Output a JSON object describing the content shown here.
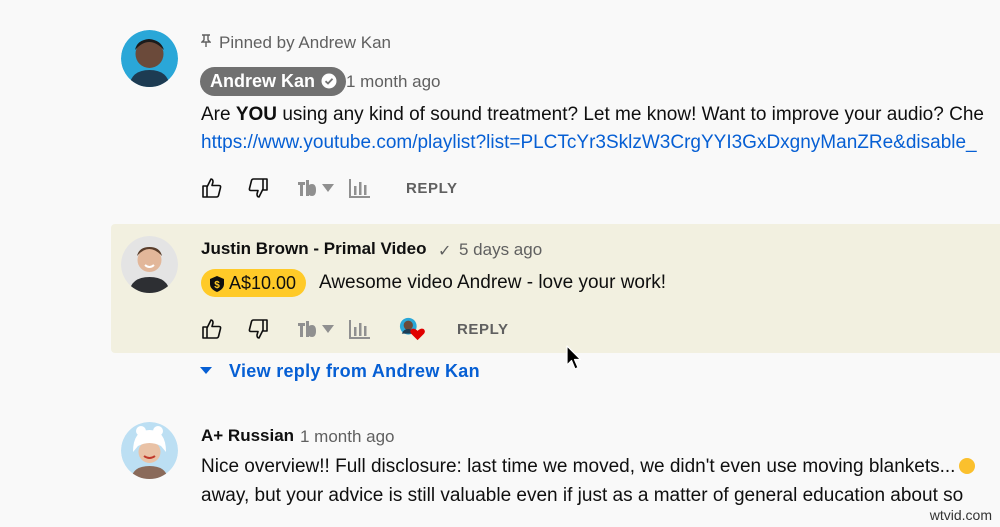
{
  "comments": [
    {
      "pinned_label": "Pinned by Andrew Kan",
      "author": "Andrew Kan",
      "time": "1 month ago",
      "text_prefix": "Are ",
      "text_bold": "YOU",
      "text_rest": " using any kind of sound treatment? Let me know! Want to improve your audio? Che",
      "link": "https://www.youtube.com/playlist?list=PLCTcYr3SklzW3CrgYYI3GxDxgnyManZRe&disable_"
    },
    {
      "author": "Justin Brown - Primal Video",
      "check": "✓",
      "time": "5 days ago",
      "superchat_amount": "A$10.00",
      "text": "Awesome video Andrew - love your work!",
      "view_reply": "View reply from Andrew Kan"
    },
    {
      "author": "A+ Russian",
      "time": "1 month ago",
      "line1": "Nice overview!! Full disclosure: last time we moved, we didn't even use moving blankets...",
      "line2": "away, but your advice is still valuable even if just as a matter of general education about so"
    }
  ],
  "actions": {
    "reply_label": "REPLY"
  },
  "icons": {
    "like": "thumbs-up-icon",
    "dislike": "thumbs-down-icon",
    "tubebuddy": "tubebuddy-icon",
    "caret": "caret-down-icon",
    "stats": "bar-chart-icon",
    "pin": "pin-icon",
    "verified": "verified-check-icon",
    "superchat": "super-thanks-icon",
    "heart": "creator-heart-icon"
  },
  "colors": {
    "link": "#065fd4",
    "highlight": "#f2f0e0",
    "superchat": "#ffca28",
    "chip": "#717171"
  },
  "watermark": "wtvid.com"
}
